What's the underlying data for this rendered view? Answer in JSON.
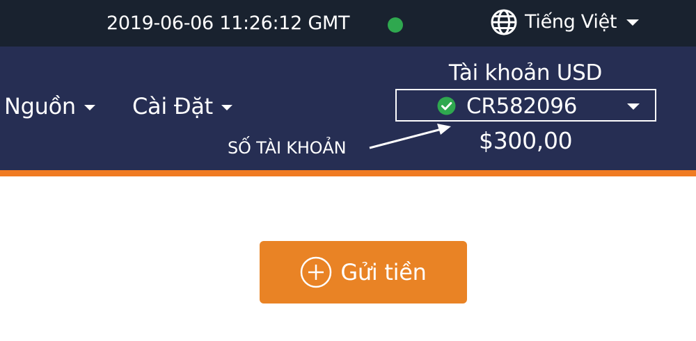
{
  "topbar": {
    "datetime": "2019-06-06 11:26:12 GMT",
    "status_color": "#2fa84f",
    "language": {
      "icon": "globe-icon",
      "label": "Tiếng Việt"
    }
  },
  "nav": {
    "menus": [
      {
        "label": "Nguồn",
        "icon": "chevron-down-icon"
      },
      {
        "label": "Cài Đặt",
        "icon": "chevron-down-icon"
      }
    ]
  },
  "account": {
    "title": "Tài khoản USD",
    "status_icon": "check-circle-icon",
    "number": "CR582096",
    "balance": "$300,00"
  },
  "annotation": {
    "label": "SỐ TÀI KHOẢN"
  },
  "deposit": {
    "icon": "plus-circle-icon",
    "label": "Gửi tiền"
  },
  "colors": {
    "topbar": "#19222f",
    "navbar": "#262e53",
    "accent": "#f07b22",
    "button": "#e98325",
    "success": "#2fa84f"
  }
}
